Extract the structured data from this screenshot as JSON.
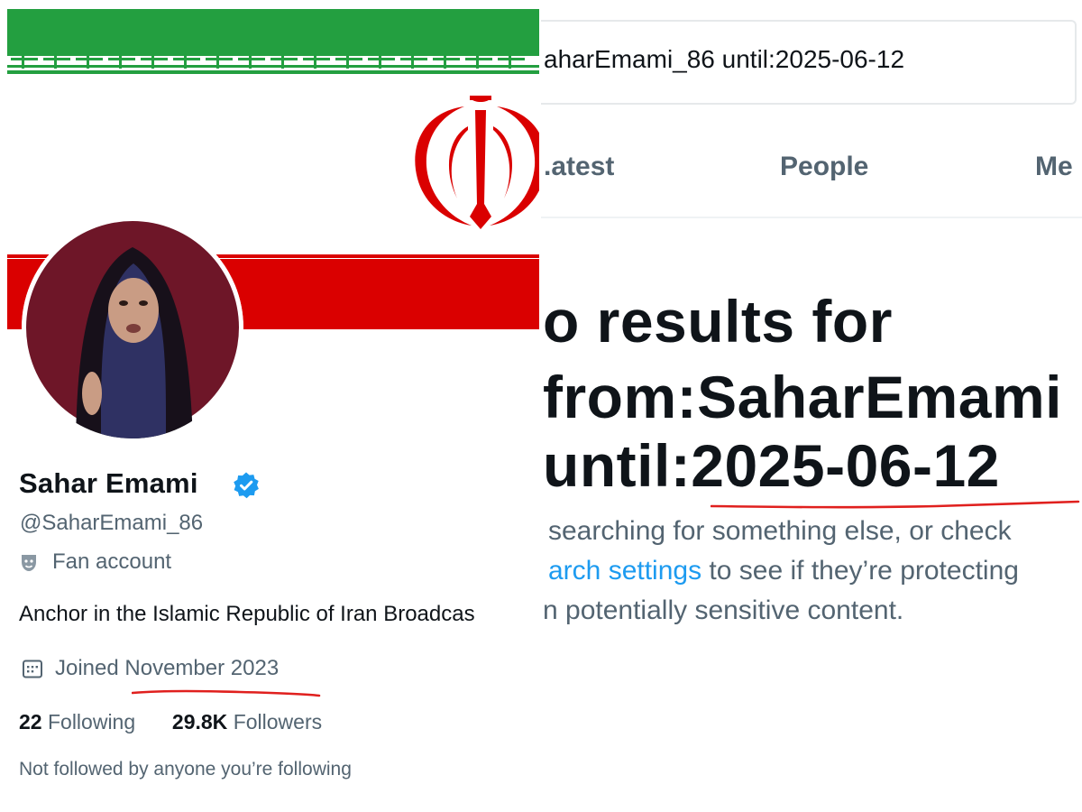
{
  "profile": {
    "display_name": "Sahar Emami",
    "handle": "@SaharEmami_86",
    "label": "Fan account",
    "bio": "Anchor in the  Islamic Republic of Iran Broadcas",
    "joined_prefix": "Joined",
    "joined_date": "November 2023",
    "following_count": "22",
    "following_label": "Following",
    "followers_count": "29.8K",
    "followers_label": "Followers",
    "mutuals_note": "Not followed by anyone you’re following",
    "verified_color": "#1d9bf0"
  },
  "search": {
    "query": "aharEmami_86 until:2025-06-12",
    "tabs": [
      "Latest",
      "People",
      "Me"
    ],
    "tabs_visible": [
      ".atest",
      "People",
      "Me"
    ],
    "headline_line1": "o results for",
    "headline_line2": "from:SaharEmami",
    "headline_line3": "until:2025-06-12",
    "body_line1": "searching for something else, or check",
    "body_line2_link": "arch settings",
    "body_line2_rest": " to see if they’re protecting",
    "body_line3": "n potentially sensitive content."
  },
  "colors": {
    "flag_green": "#239f40",
    "flag_red": "#da0000",
    "underline_red": "#e0201e",
    "link_blue": "#1d9bf0",
    "muted_gray": "#536471"
  },
  "icons": [
    "verified-badge-icon",
    "theater-mask-icon",
    "calendar-icon"
  ]
}
